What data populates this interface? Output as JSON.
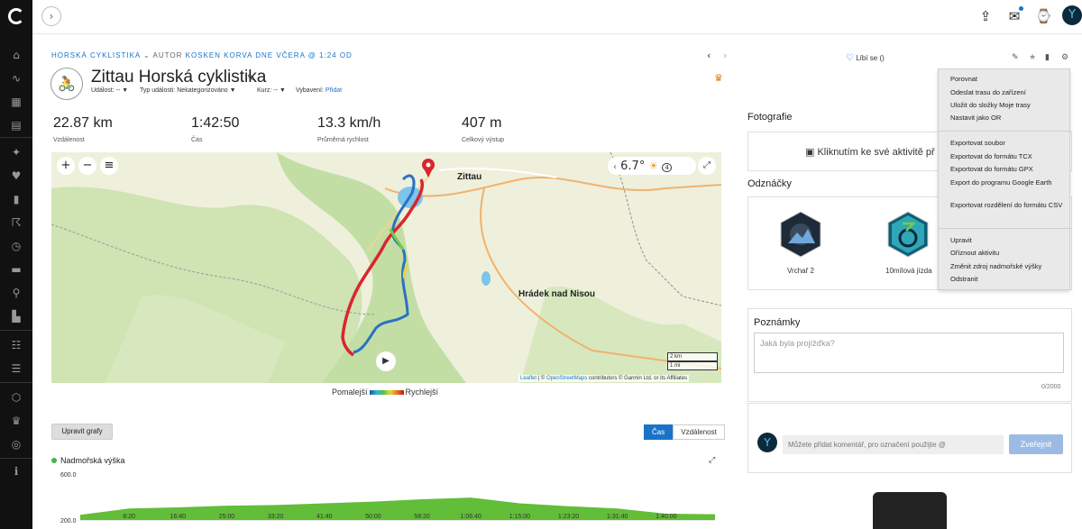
{
  "sidebar": {
    "icons": [
      "home-icon",
      "activity-icon",
      "calendar-icon",
      "news-icon",
      "training-icon",
      "health-icon",
      "reports-icon",
      "running-icon",
      "timer-icon",
      "shoe-icon",
      "location-icon",
      "stats-icon",
      "connections-icon",
      "groups-icon",
      "badges-icon",
      "trophy-icon",
      "challenge-icon",
      "info-icon"
    ]
  },
  "topbar": {
    "expand": "›",
    "upload": "⇪",
    "inbox": "✉",
    "device": "⌚",
    "avatar": "Y"
  },
  "breadcrumb": {
    "category": "HORSKÁ CYKLISTIKA",
    "by": " ⌄ AUTOR ",
    "author": "KOSKEN KORVA",
    "when": " DNE VČERA @ 1:24 OD"
  },
  "nav": {
    "prev": "‹",
    "next": "›"
  },
  "activity": {
    "icon": "🚴",
    "title": "Zittau Horská cyklistika",
    "meta": {
      "event_label": "Událost: -- ▼",
      "event_type_label": "Typ události: Nekategorizováno ▼",
      "course_label": "Kurz: -- ▼",
      "gear_label": "Vybavení: ",
      "gear_link": "Přidat"
    }
  },
  "stats": [
    {
      "value": "22.87 km",
      "label": "Vzdálenost"
    },
    {
      "value": "1:42:50",
      "label": "Čas"
    },
    {
      "value": "13.3 km/h",
      "label": "Průměrná rychlost"
    },
    {
      "value": "407 m",
      "label": "Celkový výstup"
    }
  ],
  "map": {
    "zoom_in": "+",
    "zoom_out": "−",
    "layers": "≡",
    "weather_prev": "‹",
    "temperature": "6.7°",
    "weather_icon": "☀",
    "wind": "4",
    "fullscreen": "⤢",
    "play": "▶",
    "scale_km": "2 km",
    "scale_mi": "1 mi",
    "labels": {
      "city1": "Zittau",
      "city2": "Hrádek nad Nisou"
    },
    "attribution_leaflet": "Leaflet",
    "attribution_osm": "OpenStreetMaps",
    "attribution_rest": " contributors © Garmin Ltd. or its Affiliates",
    "attribution_sep": " | © "
  },
  "speed_legend": {
    "slow": "Pomalejší",
    "fast": "Rychlejší"
  },
  "charts": {
    "edit_button": "Upravit grafy",
    "toggle_time": "Čas",
    "toggle_distance": "Vzdálenost",
    "elevation_title": "Nadmořská výška",
    "expand": "⤢"
  },
  "chart_data": {
    "type": "area",
    "title": "Nadmořská výška",
    "x_ticks": [
      "8:20",
      "16:40",
      "25:00",
      "33:20",
      "41:40",
      "50:00",
      "58:20",
      "1:06:40",
      "1:15:00",
      "1:23:20",
      "1:31:40",
      "1:40:00"
    ],
    "y_ticks": [
      "600.0",
      "200.0"
    ],
    "ylim": [
      200,
      600
    ],
    "x": [
      "0:00",
      "8:20",
      "16:40",
      "25:00",
      "33:20",
      "41:40",
      "50:00",
      "58:20",
      "1:06:40",
      "1:15:00",
      "1:23:20",
      "1:31:40",
      "1:40:00",
      "1:42:50"
    ],
    "values": [
      245,
      300,
      310,
      325,
      330,
      345,
      360,
      380,
      395,
      345,
      320,
      300,
      255,
      250
    ],
    "color": "#5ab92e"
  },
  "right": {
    "like": "Líbí se ()",
    "heart": "♡",
    "edit_icon": "✎",
    "star_icon": "★",
    "lock_icon": "🔒",
    "gear_icon": "⚙",
    "photos_title": "Fotografie",
    "photo_prompt": "Kliknutím ke své aktivitě př",
    "camera_icon": "📷",
    "badges_title": "Odznáčky",
    "badges": [
      {
        "name": "Vrchař 2"
      },
      {
        "name": "10mílová jízda"
      }
    ],
    "notes_title": "Poznámky",
    "notes_placeholder": "Jaká byla projížďka?",
    "notes_count": "0/2000",
    "comment_placeholder": "Můžete přidat komentář, pro označení použijte @",
    "publish": "Zveřejnit",
    "avatar": "Y"
  },
  "menu": {
    "group1": [
      "Porovnat",
      "Odeslat trasu do zařízení",
      "Uložit do složky Moje trasy",
      "Nastavit jako OR"
    ],
    "group2": [
      "Exportovat soubor",
      "Exportovat do formátu TCX",
      "Exportovat do formátu GPX",
      "Export do programu Google Earth",
      "Exportovat rozdělení do formátu CSV"
    ],
    "group3": [
      "Upravit",
      "Oříznout aktivitu",
      "Změnit zdroj nadmořské výšky",
      "Odstranit"
    ]
  },
  "colors": {
    "accent": "#1a73c9",
    "route_slow": "#1a4fa8",
    "route_fast": "#c4151c"
  }
}
